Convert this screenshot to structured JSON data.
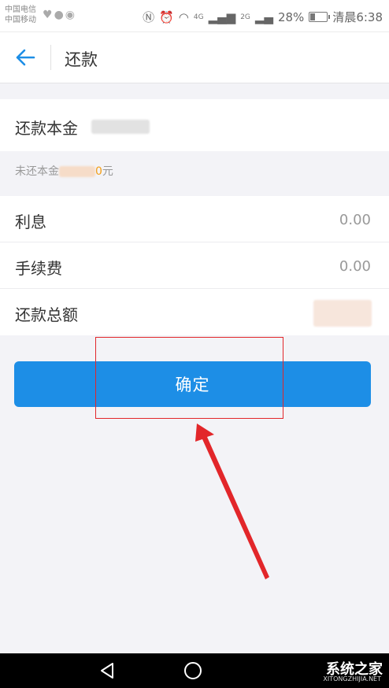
{
  "status_bar": {
    "carrier_1": "中国电信",
    "carrier_2": "中国移动",
    "signal_1": "4G",
    "signal_2": "2G",
    "battery": "28%",
    "battery_level": 0.28,
    "time": "清晨6:38"
  },
  "nav": {
    "title": "还款"
  },
  "principal": {
    "label": "还款本金"
  },
  "hint": {
    "prefix": "未还本金",
    "suffix_amount": "0",
    "suffix_unit": "元"
  },
  "details": [
    {
      "label": "利息",
      "value": "0.00"
    },
    {
      "label": "手续费",
      "value": "0.00"
    },
    {
      "label": "还款总额",
      "value": ""
    }
  ],
  "confirm_button": "确定",
  "watermark": {
    "name": "系统之家",
    "url": "XITONGZHIJIA.NET"
  },
  "colors": {
    "accent": "#1d8ee6",
    "annotation": "#e2262a",
    "hint_amount": "#f39c12"
  }
}
